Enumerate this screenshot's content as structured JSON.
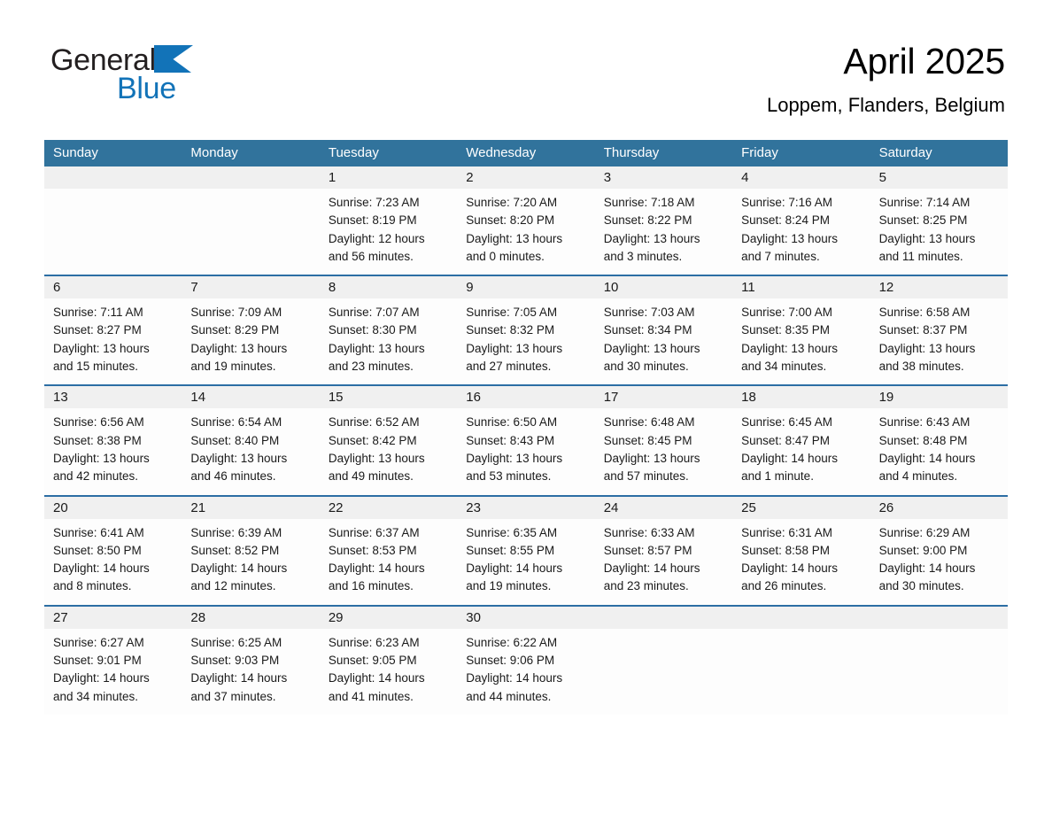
{
  "brand": {
    "name_part1": "General",
    "name_part2": "Blue",
    "triangle_color": "#1273b8",
    "text_color": "#231f20"
  },
  "header": {
    "title": "April 2025",
    "subtitle": "Loppem, Flanders, Belgium"
  },
  "colors": {
    "header_blue": "#31739c",
    "row_rule_blue": "#2c6ea4",
    "day_band_gray": "#f0f0f0",
    "cell_white": "#fdfdfd"
  },
  "weekdays": [
    "Sunday",
    "Monday",
    "Tuesday",
    "Wednesday",
    "Thursday",
    "Friday",
    "Saturday"
  ],
  "weeks": [
    [
      {
        "day": "",
        "lines": []
      },
      {
        "day": "",
        "lines": []
      },
      {
        "day": "1",
        "lines": [
          "Sunrise: 7:23 AM",
          "Sunset: 8:19 PM",
          "Daylight: 12 hours",
          "and 56 minutes."
        ]
      },
      {
        "day": "2",
        "lines": [
          "Sunrise: 7:20 AM",
          "Sunset: 8:20 PM",
          "Daylight: 13 hours",
          "and 0 minutes."
        ]
      },
      {
        "day": "3",
        "lines": [
          "Sunrise: 7:18 AM",
          "Sunset: 8:22 PM",
          "Daylight: 13 hours",
          "and 3 minutes."
        ]
      },
      {
        "day": "4",
        "lines": [
          "Sunrise: 7:16 AM",
          "Sunset: 8:24 PM",
          "Daylight: 13 hours",
          "and 7 minutes."
        ]
      },
      {
        "day": "5",
        "lines": [
          "Sunrise: 7:14 AM",
          "Sunset: 8:25 PM",
          "Daylight: 13 hours",
          "and 11 minutes."
        ]
      }
    ],
    [
      {
        "day": "6",
        "lines": [
          "Sunrise: 7:11 AM",
          "Sunset: 8:27 PM",
          "Daylight: 13 hours",
          "and 15 minutes."
        ]
      },
      {
        "day": "7",
        "lines": [
          "Sunrise: 7:09 AM",
          "Sunset: 8:29 PM",
          "Daylight: 13 hours",
          "and 19 minutes."
        ]
      },
      {
        "day": "8",
        "lines": [
          "Sunrise: 7:07 AM",
          "Sunset: 8:30 PM",
          "Daylight: 13 hours",
          "and 23 minutes."
        ]
      },
      {
        "day": "9",
        "lines": [
          "Sunrise: 7:05 AM",
          "Sunset: 8:32 PM",
          "Daylight: 13 hours",
          "and 27 minutes."
        ]
      },
      {
        "day": "10",
        "lines": [
          "Sunrise: 7:03 AM",
          "Sunset: 8:34 PM",
          "Daylight: 13 hours",
          "and 30 minutes."
        ]
      },
      {
        "day": "11",
        "lines": [
          "Sunrise: 7:00 AM",
          "Sunset: 8:35 PM",
          "Daylight: 13 hours",
          "and 34 minutes."
        ]
      },
      {
        "day": "12",
        "lines": [
          "Sunrise: 6:58 AM",
          "Sunset: 8:37 PM",
          "Daylight: 13 hours",
          "and 38 minutes."
        ]
      }
    ],
    [
      {
        "day": "13",
        "lines": [
          "Sunrise: 6:56 AM",
          "Sunset: 8:38 PM",
          "Daylight: 13 hours",
          "and 42 minutes."
        ]
      },
      {
        "day": "14",
        "lines": [
          "Sunrise: 6:54 AM",
          "Sunset: 8:40 PM",
          "Daylight: 13 hours",
          "and 46 minutes."
        ]
      },
      {
        "day": "15",
        "lines": [
          "Sunrise: 6:52 AM",
          "Sunset: 8:42 PM",
          "Daylight: 13 hours",
          "and 49 minutes."
        ]
      },
      {
        "day": "16",
        "lines": [
          "Sunrise: 6:50 AM",
          "Sunset: 8:43 PM",
          "Daylight: 13 hours",
          "and 53 minutes."
        ]
      },
      {
        "day": "17",
        "lines": [
          "Sunrise: 6:48 AM",
          "Sunset: 8:45 PM",
          "Daylight: 13 hours",
          "and 57 minutes."
        ]
      },
      {
        "day": "18",
        "lines": [
          "Sunrise: 6:45 AM",
          "Sunset: 8:47 PM",
          "Daylight: 14 hours",
          "and 1 minute."
        ]
      },
      {
        "day": "19",
        "lines": [
          "Sunrise: 6:43 AM",
          "Sunset: 8:48 PM",
          "Daylight: 14 hours",
          "and 4 minutes."
        ]
      }
    ],
    [
      {
        "day": "20",
        "lines": [
          "Sunrise: 6:41 AM",
          "Sunset: 8:50 PM",
          "Daylight: 14 hours",
          "and 8 minutes."
        ]
      },
      {
        "day": "21",
        "lines": [
          "Sunrise: 6:39 AM",
          "Sunset: 8:52 PM",
          "Daylight: 14 hours",
          "and 12 minutes."
        ]
      },
      {
        "day": "22",
        "lines": [
          "Sunrise: 6:37 AM",
          "Sunset: 8:53 PM",
          "Daylight: 14 hours",
          "and 16 minutes."
        ]
      },
      {
        "day": "23",
        "lines": [
          "Sunrise: 6:35 AM",
          "Sunset: 8:55 PM",
          "Daylight: 14 hours",
          "and 19 minutes."
        ]
      },
      {
        "day": "24",
        "lines": [
          "Sunrise: 6:33 AM",
          "Sunset: 8:57 PM",
          "Daylight: 14 hours",
          "and 23 minutes."
        ]
      },
      {
        "day": "25",
        "lines": [
          "Sunrise: 6:31 AM",
          "Sunset: 8:58 PM",
          "Daylight: 14 hours",
          "and 26 minutes."
        ]
      },
      {
        "day": "26",
        "lines": [
          "Sunrise: 6:29 AM",
          "Sunset: 9:00 PM",
          "Daylight: 14 hours",
          "and 30 minutes."
        ]
      }
    ],
    [
      {
        "day": "27",
        "lines": [
          "Sunrise: 6:27 AM",
          "Sunset: 9:01 PM",
          "Daylight: 14 hours",
          "and 34 minutes."
        ]
      },
      {
        "day": "28",
        "lines": [
          "Sunrise: 6:25 AM",
          "Sunset: 9:03 PM",
          "Daylight: 14 hours",
          "and 37 minutes."
        ]
      },
      {
        "day": "29",
        "lines": [
          "Sunrise: 6:23 AM",
          "Sunset: 9:05 PM",
          "Daylight: 14 hours",
          "and 41 minutes."
        ]
      },
      {
        "day": "30",
        "lines": [
          "Sunrise: 6:22 AM",
          "Sunset: 9:06 PM",
          "Daylight: 14 hours",
          "and 44 minutes."
        ]
      },
      {
        "day": "",
        "lines": []
      },
      {
        "day": "",
        "lines": []
      },
      {
        "day": "",
        "lines": []
      }
    ]
  ]
}
